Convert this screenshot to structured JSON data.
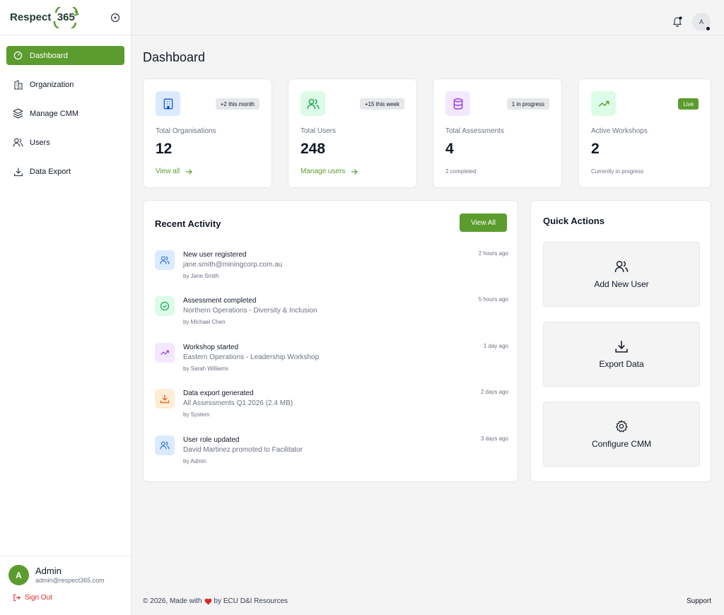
{
  "brand": {
    "name": "Respect",
    "suffix": "365",
    "primary_color": "#5c9c2e"
  },
  "sidebar": {
    "items": [
      {
        "label": "Dashboard",
        "icon": "gauge-icon",
        "active": true
      },
      {
        "label": "Organization",
        "icon": "building-icon"
      },
      {
        "label": "Manage CMM",
        "icon": "layers-icon"
      },
      {
        "label": "Users",
        "icon": "users-icon"
      },
      {
        "label": "Data Export",
        "icon": "download-icon"
      }
    ],
    "user": {
      "initial": "A",
      "name": "Admin",
      "email": "admin@respect365.com"
    },
    "signout_label": "Sign Out"
  },
  "header": {
    "avatar_initial": "A"
  },
  "main": {
    "title": "Dashboard",
    "stats": [
      {
        "label": "Total Organisations",
        "value": "12",
        "badge": "+2 this month",
        "link": "View all",
        "icon": "building-icon",
        "color": "#2563eb"
      },
      {
        "label": "Total Users",
        "value": "248",
        "badge": "+15 this week",
        "link": "Manage users",
        "icon": "users-icon",
        "color": "#16a34a"
      },
      {
        "label": "Total Assessments",
        "value": "4",
        "badge": "1 in progress",
        "foot": "2 completed",
        "icon": "database-icon",
        "color": "#9333ea"
      },
      {
        "label": "Active Workshops",
        "value": "2",
        "badge": "Live",
        "foot": "Currently in progress",
        "icon": "trending-up-icon",
        "color": "#5c9c2e"
      }
    ],
    "activity": {
      "title": "Recent Activity",
      "view_all": "View All",
      "items": [
        {
          "title": "New user registered",
          "desc": "jane.smith@miningcorp.com.au",
          "by": "by Jane Smith",
          "time": "2 hours ago",
          "icon": "users-icon",
          "color": "#2563eb"
        },
        {
          "title": "Assessment completed",
          "desc": "Northern Operations - Diversity & Inclusion",
          "by": "by Michael Chen",
          "time": "5 hours ago",
          "icon": "check-circle-icon",
          "color": "#16a34a"
        },
        {
          "title": "Workshop started",
          "desc": "Eastern Operations - Leadership Workshop",
          "by": "by Sarah Williams",
          "time": "1 day ago",
          "icon": "trending-up-icon",
          "color": "#9333ea"
        },
        {
          "title": "Data export generated",
          "desc": "All Assessments Q1 2026 (2.4 MB)",
          "by": "by System",
          "time": "2 days ago",
          "icon": "download-icon",
          "color": "#ea580c"
        },
        {
          "title": "User role updated",
          "desc": "David Martinez promoted to Facilitator",
          "by": "by Admin",
          "time": "3 days ago",
          "icon": "users-icon",
          "color": "#2563eb"
        }
      ]
    },
    "quick": {
      "title": "Quick Actions",
      "actions": [
        {
          "label": "Add New User",
          "icon": "users-icon"
        },
        {
          "label": "Export Data",
          "icon": "download-icon"
        },
        {
          "label": "Configure CMM",
          "icon": "gear-icon"
        }
      ]
    }
  },
  "footer": {
    "pre": "© 2026, Made with",
    "post": "by ECU D&I Resources",
    "support": "Support"
  }
}
